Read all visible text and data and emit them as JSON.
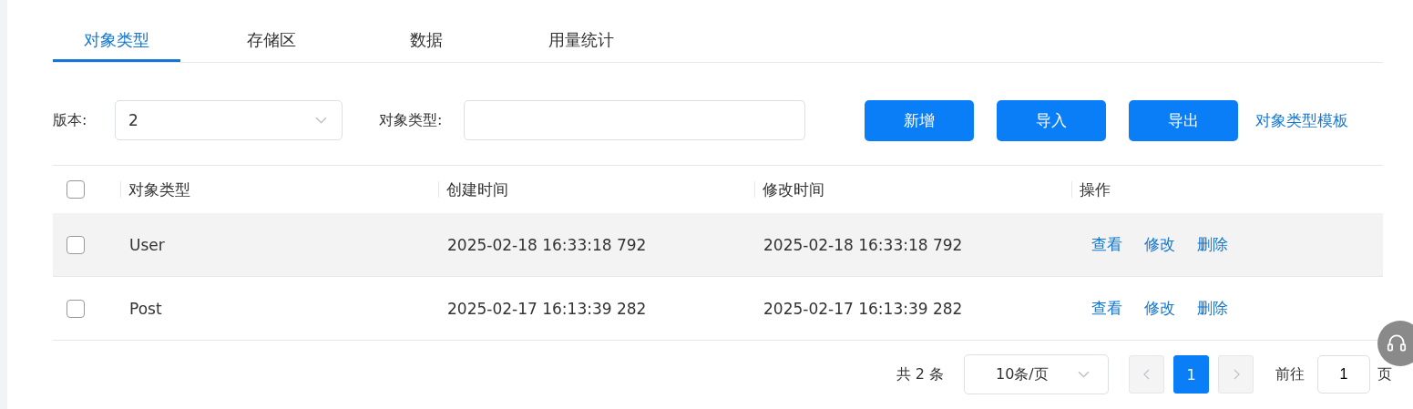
{
  "tabs": [
    {
      "label": "对象类型",
      "selected": true
    },
    {
      "label": "存储区",
      "selected": false
    },
    {
      "label": "数据",
      "selected": false
    },
    {
      "label": "用量统计",
      "selected": false
    }
  ],
  "filters": {
    "version_label": "版本:",
    "version_value": "2",
    "type_label": "对象类型:"
  },
  "buttons": [
    "新增",
    "导入",
    "导出"
  ],
  "template_link": "对象类型模板",
  "table": {
    "select_all_checked": false,
    "columns": [
      "对象类型",
      "创建时间",
      "修改时间",
      "操作"
    ],
    "rows": [
      {
        "checked": false,
        "hovered": true,
        "cells": [
          "User",
          "2025-02-18 16:33:18 792",
          "2025-02-18 16:33:18 792"
        ],
        "actions": [
          "查看",
          "修改",
          "删除"
        ]
      },
      {
        "checked": false,
        "hovered": false,
        "cells": [
          "Post",
          "2025-02-17 16:13:39 282",
          "2025-02-17 16:13:39 282"
        ],
        "actions": [
          "查看",
          "修改",
          "删除"
        ]
      }
    ]
  },
  "pagination": {
    "total": "共 2 条",
    "page_size": "10条/页",
    "pages": [
      {
        "label": "1",
        "selected": true
      }
    ],
    "goto_label": "前往",
    "goto_value": "1",
    "goto_suffix": "页"
  }
}
